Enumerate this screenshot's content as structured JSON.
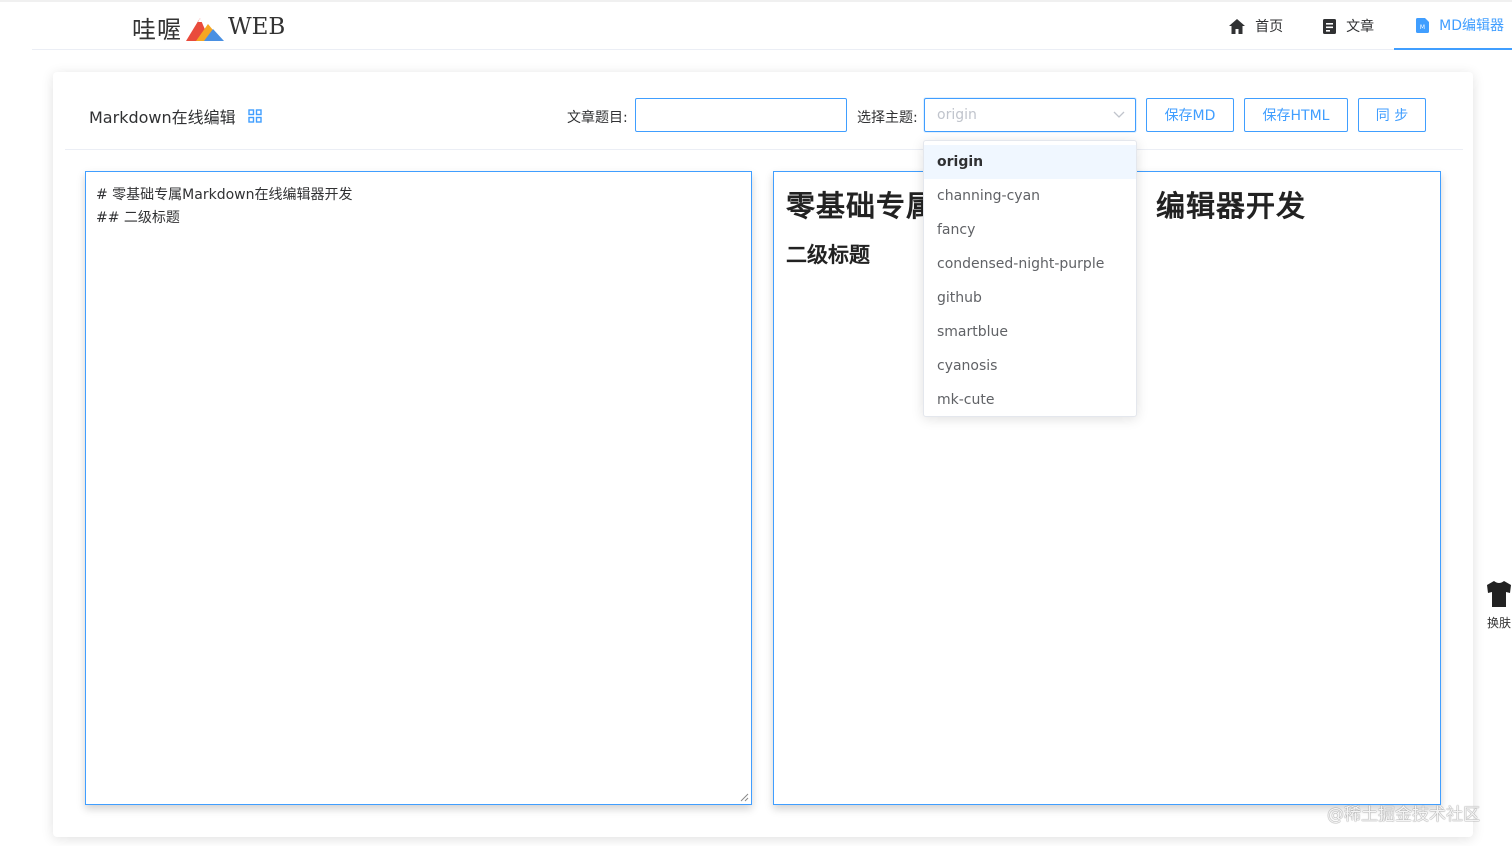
{
  "logo": {
    "cn": "哇喔",
    "en": "WEB"
  },
  "nav": {
    "home": "首页",
    "articles": "文章",
    "md_editor": "MD编辑器"
  },
  "card": {
    "title": "Markdown在线编辑",
    "article_title_label": "文章题目:",
    "article_title_value": "",
    "theme_label": "选择主题:",
    "theme_placeholder": "origin",
    "save_md": "保存MD",
    "save_html": "保存HTML",
    "sync": "同 步"
  },
  "editor": {
    "line1": "# 零基础专属Markdown在线编辑器开发",
    "line2": "## 二级标题"
  },
  "preview": {
    "h1_left": "零基础专属",
    "h1_right": "编辑器开发",
    "h2": "二级标题"
  },
  "theme_options": [
    "origin",
    "channing-cyan",
    "fancy",
    "condensed-night-purple",
    "github",
    "smartblue",
    "cyanosis",
    "mk-cute"
  ],
  "skin": {
    "label": "换肤"
  },
  "watermark": "@稀土掘金技术社区",
  "colors": {
    "accent": "#409eff",
    "text": "#303133"
  }
}
